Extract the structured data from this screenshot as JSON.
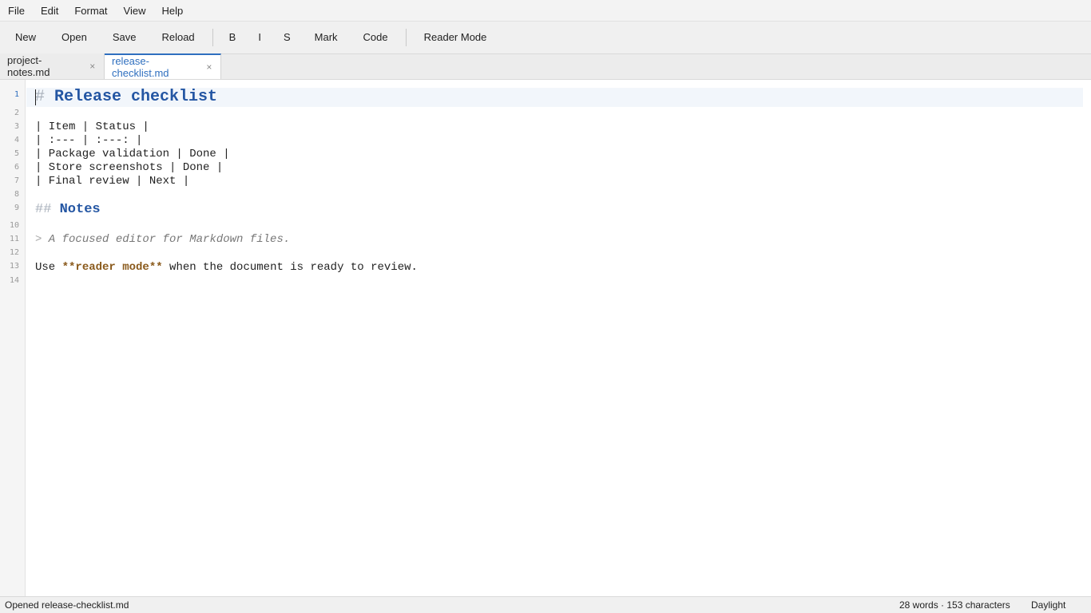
{
  "menu": [
    "File",
    "Edit",
    "Format",
    "View",
    "Help"
  ],
  "toolbar": {
    "new": "New",
    "open": "Open",
    "save": "Save",
    "reload": "Reload",
    "bold": "B",
    "italic": "I",
    "strike": "S",
    "mark": "Mark",
    "code": "Code",
    "reader_mode": "Reader Mode"
  },
  "tabs": [
    {
      "label": "project-notes.md",
      "close": "×",
      "active": false
    },
    {
      "label": "release-checklist.md",
      "close": "×",
      "active": true
    }
  ],
  "editor": {
    "line_numbers": [
      "1",
      "2",
      "3",
      "4",
      "5",
      "6",
      "7",
      "8",
      "9",
      "10",
      "11",
      "12",
      "13",
      "14"
    ],
    "current_line": 1,
    "lines": {
      "l1_marker": "#",
      "l1_text": " Release checklist",
      "l3": "| Item | Status |",
      "l4": "| :--- | :---: |",
      "l5": "| Package validation | Done |",
      "l6": "| Store screenshots | Done |",
      "l7": "| Final review | Next |",
      "l9_marker": "##",
      "l9_text": " Notes",
      "l11_marker": ">",
      "l11_text": " A focused editor for Markdown files.",
      "l13_pre": "Use ",
      "l13_bold": "**reader mode**",
      "l13_post": " when the document is ready to review."
    }
  },
  "status": {
    "message": "Opened release-checklist.md",
    "counts": "28 words · 153 characters",
    "theme": "Daylight"
  },
  "colors": {
    "accent": "#2f6fbf",
    "heading": "#2456a3",
    "bold_markdown": "#8a5a1c"
  }
}
